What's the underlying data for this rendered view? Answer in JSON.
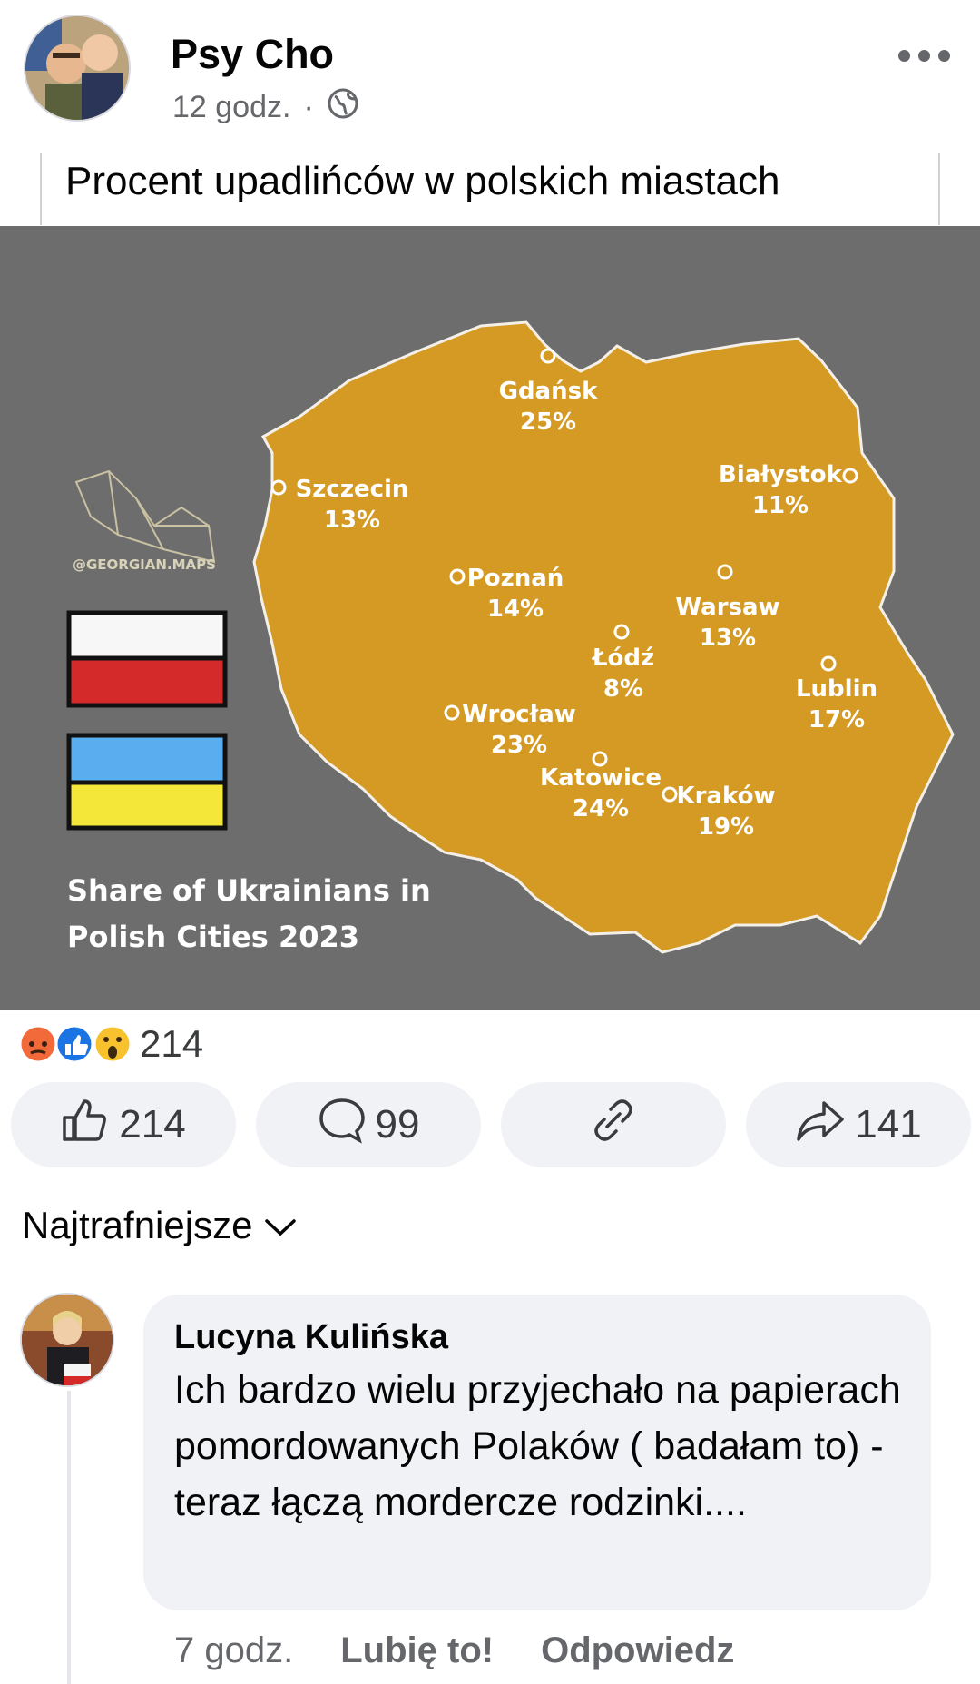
{
  "post": {
    "author": "Psy Cho",
    "time": "12 godz.",
    "separator": "·",
    "audience_icon": "globe-icon",
    "caption": "Procent upadlińców w polskich miastach"
  },
  "image": {
    "title_line1": "Share of Ukrainians in",
    "title_line2": "Polish Cities 2023",
    "watermark": "@GEORGIAN.MAPS",
    "map_color": "#d49a24",
    "background_color": "#6d6d6d",
    "cities": [
      {
        "name": "Gdańsk",
        "value": "25%"
      },
      {
        "name": "Szczecin",
        "value": "13%"
      },
      {
        "name": "Białystok",
        "value": "11%"
      },
      {
        "name": "Poznań",
        "value": "14%"
      },
      {
        "name": "Warsaw",
        "value": "13%"
      },
      {
        "name": "Łódź",
        "value": "8%"
      },
      {
        "name": "Lublin",
        "value": "17%"
      },
      {
        "name": "Wrocław",
        "value": "23%"
      },
      {
        "name": "Katowice",
        "value": "24%"
      },
      {
        "name": "Kraków",
        "value": "19%"
      }
    ]
  },
  "reactions": {
    "total": "214",
    "types": [
      "angry-icon",
      "like-icon",
      "wow-icon"
    ]
  },
  "actions": {
    "like_count": "214",
    "comment_count": "99",
    "share_count": "141"
  },
  "comments_sort": "Najtrafniejsze",
  "comment": {
    "author": "Lucyna Kulińska",
    "text": "Ich bardzo wielu przyjechało na papierach pomordowanych Polaków ( badałam to) - teraz łączą mordercze rodzinki....",
    "time": "7 godz.",
    "like_label": "Lubię to!",
    "reply_label": "Odpowiedz"
  }
}
